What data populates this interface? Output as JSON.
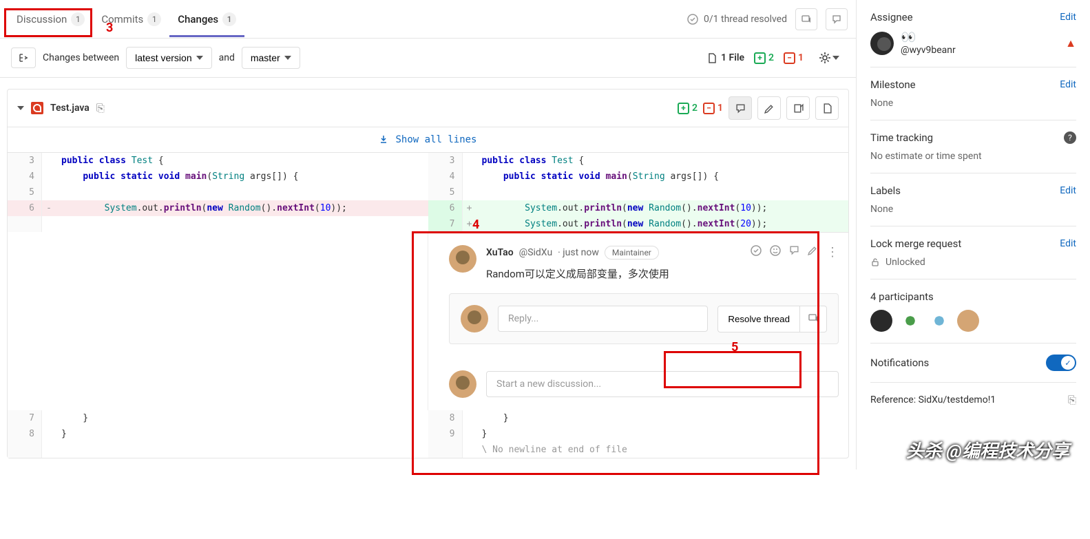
{
  "tabs": {
    "discussion": "Discussion",
    "discussion_count": "1",
    "commits": "Commits",
    "commits_count": "1",
    "changes": "Changes",
    "changes_count": "1"
  },
  "thread_status": "0/1 thread resolved",
  "toolbar": {
    "changes_between": "Changes between",
    "latest_version": "latest version",
    "and": "and",
    "master": "master",
    "file_count": "1 File",
    "additions": "2",
    "deletions": "1"
  },
  "file": {
    "name": "Test.java",
    "additions": "2",
    "deletions": "1",
    "show_all": "Show all lines"
  },
  "diff": {
    "l3": "3",
    "l4": "4",
    "l5": "5",
    "l6": "6",
    "l7": "7",
    "l8": "8",
    "r3": "3",
    "r4": "4",
    "r5": "5",
    "r6": "6",
    "r7": "7",
    "r8": "8",
    "r9": "9",
    "no_newline": "\\ No newline at end of file"
  },
  "comment": {
    "author": "XuTao",
    "handle": "@SidXu",
    "time": "· just now",
    "badge": "Maintainer",
    "text": "Random可以定义成局部变量，多次使用",
    "reply_placeholder": "Reply...",
    "resolve": "Resolve thread",
    "new_placeholder": "Start a new discussion..."
  },
  "sidebar": {
    "assignee": "Assignee",
    "assignee_handle": "@wyv9beanr",
    "milestone": "Milestone",
    "milestone_val": "None",
    "time_tracking": "Time tracking",
    "time_val": "No estimate or time spent",
    "labels": "Labels",
    "labels_val": "None",
    "lock": "Lock merge request",
    "unlocked": "Unlocked",
    "participants": "4 participants",
    "notifications": "Notifications",
    "reference": "Reference: SidXu/testdemo!1",
    "edit": "Edit"
  },
  "annotations": {
    "n3": "3",
    "n4": "4",
    "n5": "5"
  },
  "watermark": "头杀 @编程技术分享"
}
